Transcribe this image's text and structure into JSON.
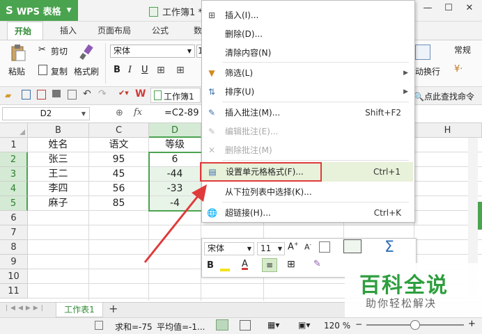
{
  "app": {
    "name": "WPS 表格",
    "logo": "S",
    "doc_title": "工作簿1 *"
  },
  "tabs": [
    "开始",
    "插入",
    "页面布局",
    "公式",
    "数"
  ],
  "ribbon": {
    "cut": "剪切",
    "paste": "粘贴",
    "copy": "复制",
    "format_painter": "格式刷",
    "font_name": "宋体",
    "font_size": "1",
    "bold": "B",
    "italic": "I",
    "underline": "U",
    "wrap": "动换行",
    "number_format": "常规"
  },
  "quick_access": {
    "doc_tab": "工作簿1",
    "search": "点此查找命令"
  },
  "formula_bar": {
    "name_box": "D2",
    "fx": "fx",
    "formula": "=C2-89"
  },
  "columns": [
    "B",
    "C",
    "D",
    "H"
  ],
  "rows": [
    "1",
    "2",
    "3",
    "4",
    "5",
    "6",
    "7",
    "8",
    "9",
    "10",
    "11"
  ],
  "table": {
    "headers": [
      "姓名",
      "语文",
      "等级"
    ],
    "data": [
      [
        "张三",
        "95",
        "6"
      ],
      [
        "王二",
        "45",
        "-44"
      ],
      [
        "李四",
        "56",
        "-33"
      ],
      [
        "麻子",
        "85",
        "-4"
      ]
    ]
  },
  "context_menu": [
    {
      "label": "插入(I)...",
      "icon": "insert-icon"
    },
    {
      "label": "删除(D)...",
      "icon": ""
    },
    {
      "label": "清除内容(N)",
      "icon": ""
    },
    {
      "label": "筛选(L)",
      "icon": "filter-icon",
      "submenu": true
    },
    {
      "label": "排序(U)",
      "icon": "sort-icon",
      "submenu": true
    },
    {
      "label": "插入批注(M)...",
      "shortcut": "Shift+F2",
      "icon": "comment-icon"
    },
    {
      "label": "编辑批注(E)...",
      "disabled": true,
      "icon": "edit-comment-icon"
    },
    {
      "label": "删除批注(M)",
      "disabled": true,
      "icon": "delete-comment-icon"
    },
    {
      "label": "设置单元格格式(F)...",
      "shortcut": "Ctrl+1",
      "icon": "format-cells-icon",
      "highlighted": true
    },
    {
      "label": "从下拉列表中选择(K)...",
      "icon": ""
    },
    {
      "label": "超链接(H)...",
      "shortcut": "Ctrl+K",
      "icon": "hyperlink-icon"
    }
  ],
  "mini_toolbar": {
    "font": "宋体",
    "size": "11",
    "bold": "B"
  },
  "sheet_tab": "工作表1",
  "status": {
    "sum": "求和=-75",
    "avg": "平均值=-1...",
    "zoom": "120 %"
  },
  "watermark": {
    "title": "百科全说",
    "subtitle": "助你轻松解决"
  },
  "colors": {
    "brand_green": "#4aa34f",
    "highlight_red": "#e03a3a",
    "watermark_green": "#2e9e3e"
  }
}
